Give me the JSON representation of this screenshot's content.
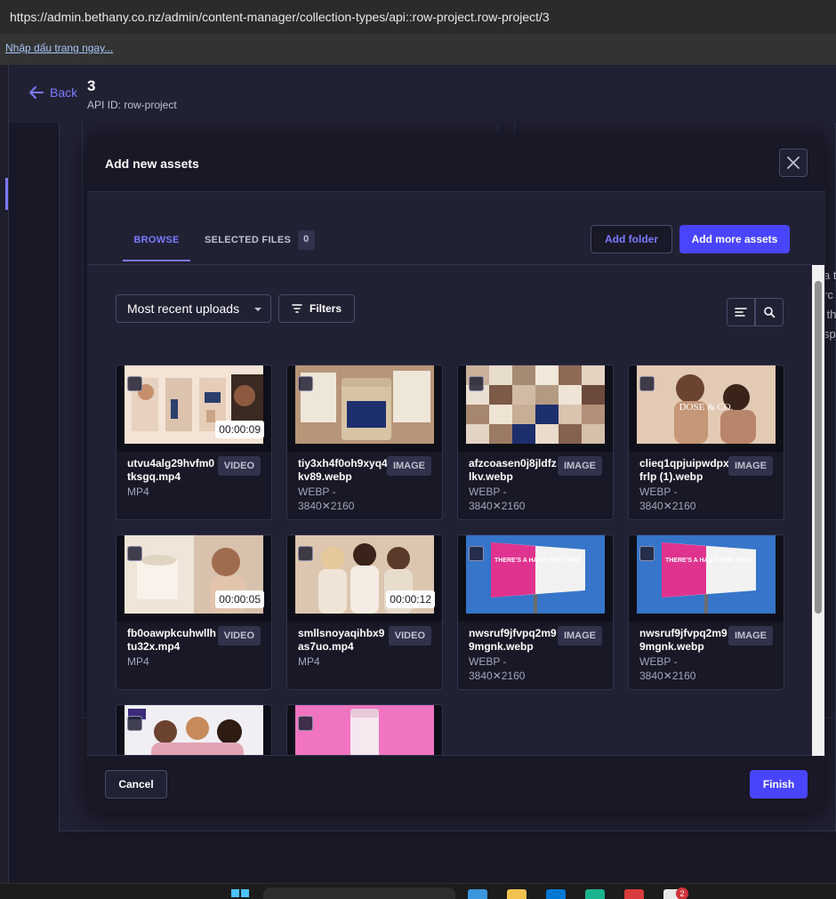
{
  "browser": {
    "url": "https://admin.bethany.co.nz/admin/content-manager/collection-types/api::row-project.row-project/3",
    "bookmark_link": "Nhập dấu trang ngay..."
  },
  "header": {
    "back_label": "Back",
    "title": "3",
    "api_id": "API ID: row-project"
  },
  "background_text": "a t\nrc\n th\nsp",
  "modal": {
    "title": "Add new assets",
    "tabs": [
      {
        "label": "BROWSE",
        "active": true
      },
      {
        "label": "SELECTED FILES",
        "count": "0"
      }
    ],
    "add_folder_label": "Add folder",
    "add_assets_label": "Add more assets",
    "sort_label": "Most recent uploads",
    "filters_label": "Filters",
    "cancel_label": "Cancel",
    "finish_label": "Finish"
  },
  "assets": [
    {
      "name": "utvu4alg29hvfm0tksgq.mp4",
      "type": "VIDEO",
      "meta": "MP4",
      "duration": "00:00:09"
    },
    {
      "name": "tiy3xh4f0oh9xyq4kv89.webp",
      "type": "IMAGE",
      "meta": "WEBP - 3840✕2160"
    },
    {
      "name": "afzcoasen0j8jldfzlkv.webp",
      "type": "IMAGE",
      "meta": "WEBP - 3840✕2160"
    },
    {
      "name": "clieq1qpjuipwdpxfrlp (1).webp",
      "type": "IMAGE",
      "meta": "WEBP - 3840✕2160"
    },
    {
      "name": "fb0oawpkcuhwllhtu32x.mp4",
      "type": "VIDEO",
      "meta": "MP4",
      "duration": "00:00:05"
    },
    {
      "name": "smllsnoyaqihbx9as7uo.mp4",
      "type": "VIDEO",
      "meta": "MP4",
      "duration": "00:00:12"
    },
    {
      "name": "nwsruf9jfvpq2m99mgnk.webp",
      "type": "IMAGE",
      "meta": "WEBP - 3840✕2160"
    },
    {
      "name": "nwsruf9jfvpq2m99mgnk.webp",
      "type": "IMAGE",
      "meta": "WEBP - 3840✕2160"
    }
  ],
  "thumb_text": {
    "dose_co": "DOSE & CO.",
    "billboard": "THERE'S A HABIT FOR THAT",
    "notification_count": "2"
  },
  "colors": {
    "accent": "#7b79ff",
    "primary": "#4945ff",
    "surface": "#212134",
    "background": "#181826"
  }
}
